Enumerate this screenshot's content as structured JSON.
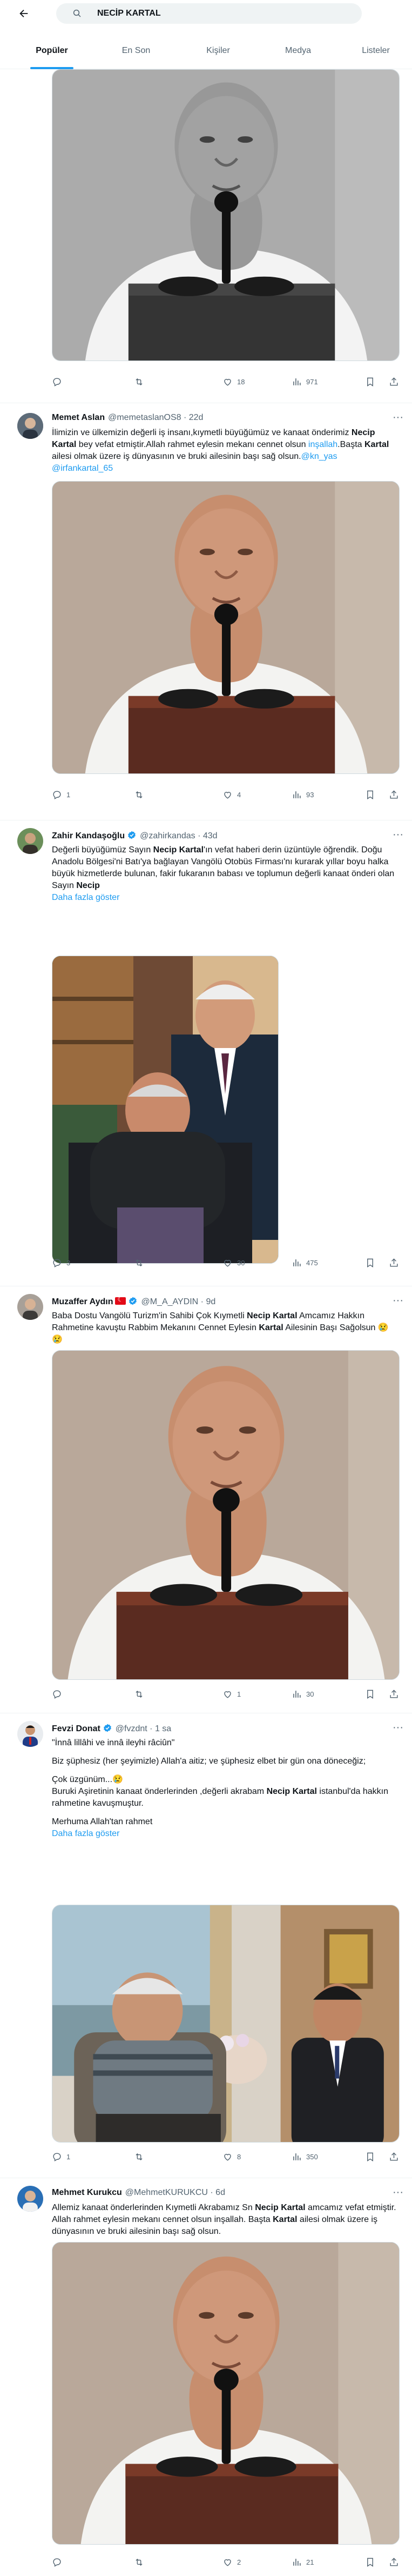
{
  "search": {
    "query": "NECİP KARTAL"
  },
  "tabs": [
    "Popüler",
    "En Son",
    "Kişiler",
    "Medya",
    "Listeler"
  ],
  "tweets": [
    {
      "actions": {
        "reply": "",
        "retweet": "",
        "like": "18",
        "views": "971"
      }
    },
    {
      "author": "Memet Aslan",
      "handle": "@memetaslanOS8 · 22d",
      "text": {
        "p1": "İlimizin ve ülkemizin değerli iş insanı,kıymetli büyüğümüz ve kanaat önderimiz ",
        "b1": "Necip Kartal",
        "p2": " bey vefat etmiştir.Allah rahmet eylesin mekanı cennet olsun ",
        "l1": "inşallah",
        "p3": ".Başta ",
        "b2": "Kartal",
        "p4": " ailesi olmak üzere iş dünyasının ve bruki ailesinin başı sağ olsun.",
        "l2": "@kn_yas @irfankartal_65"
      },
      "actions": {
        "reply": "1",
        "retweet": "",
        "like": "4",
        "views": "93"
      }
    },
    {
      "author": "Zahir Kandaşoğlu",
      "handle": "@zahirkandas · 43d",
      "text": {
        "p1": "Değerli büyüğümüz Sayın ",
        "b1": "Necip Kartal",
        "p2": "'ın vefat haberi derin üzüntüyle öğrendik. Doğu Anadolu Bölgesi'ni Batı'ya bağlayan Vangölü Otobüs Firması'nı kurarak yıllar boyu halka büyük hizmetlerde bulunan, fakir fukaranın babası ve toplumun değerli kanaat önderi olan Sayın ",
        "b2": "Necip",
        "more": "Daha fazla göster"
      },
      "actions": {
        "reply": "3",
        "retweet": "",
        "like": "30",
        "views": "475"
      }
    },
    {
      "author": "Muzaffer Aydın",
      "handle": "@M_A_AYDIN · 9d",
      "text": {
        "p1": "Baba Dostu Vangölü Turizm'in Sahibi Çok Kıymetli ",
        "b1": "Necip Kartal",
        "p2": " Amcamız Hakkın Rahmetine kavuştu Rabbim Mekanını Cennet Eylesin ",
        "b2": "Kartal",
        "p3": " Ailesinin Başı Sağolsun 😢😢"
      },
      "actions": {
        "reply": "",
        "retweet": "",
        "like": "1",
        "views": "30"
      }
    },
    {
      "author": "Fevzi Donat",
      "handle": "@fvzdnt · 1 sa",
      "text": {
        "q1": "\"İnnâ lillâhi ve innâ ileyhi râciûn\"",
        "q2": "Biz şüphesiz (her şeyimizle) Allah'a aitiz; ve şüphesiz elbet bir gün ona döneceğiz;",
        "q3": "Çok üzgünüm...😢",
        "q4a": "Buruki Aşiretinin kanaat önderlerinden ,değerli akrabam ",
        "b1": "Necip Kartal",
        "q4b": " istanbul'da hakkın rahmetine kavuşmuştur.",
        "q5": "Merhuma Allah'tan rahmet",
        "more": "Daha fazla göster"
      },
      "actions": {
        "reply": "1",
        "retweet": "",
        "like": "8",
        "views": "350"
      }
    },
    {
      "author": "Mehmet Kurukcu",
      "handle": "@MehmetKURUKCU · 6d",
      "text": {
        "p1": "Allemiz kanaat önderlerinden Kıymetli Akrabamız Sn ",
        "b1": "Necip Kartal",
        "p2": " amcamız vefat etmiştir. Allah rahmet eylesin mekanı cennet olsun inşallah. Başta ",
        "b2": "Kartal",
        "p3": " ailesi olmak üzere iş dünyasının ve bruki ailesinin başı sağ olsun."
      },
      "actions": {
        "reply": "",
        "retweet": "",
        "like": "2",
        "views": "21"
      }
    }
  ]
}
